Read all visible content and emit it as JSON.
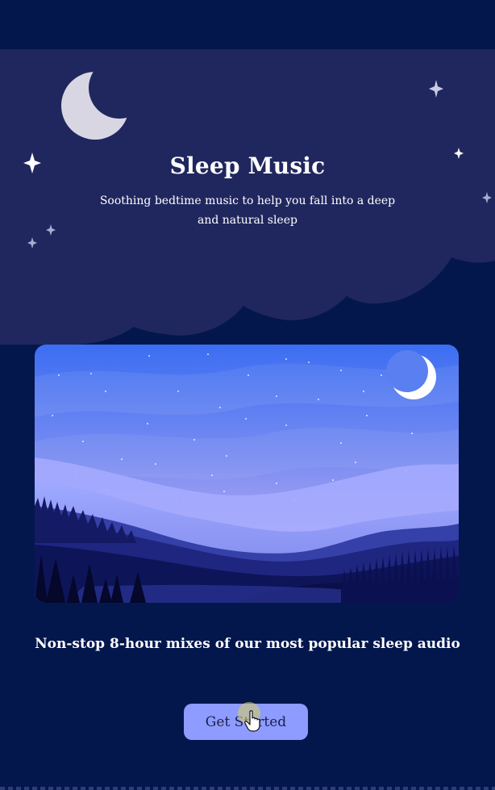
{
  "hero": {
    "title": "Sleep Music",
    "subtitle": "Soothing bedtime music to help you fall into a deep and natural sleep"
  },
  "tagline": "Non-stop 8-hour mixes of our most popular sleep audio",
  "cta": {
    "label": "Get Started"
  },
  "icons": [
    "moon-icon",
    "sparkle-icon",
    "cursor-pointer-icon"
  ],
  "colors": {
    "page_background": "#03174c",
    "hero_background": "#20275e",
    "button_background": "#8e9bff",
    "button_text": "#1b1f4a",
    "text": "#ffffff"
  }
}
